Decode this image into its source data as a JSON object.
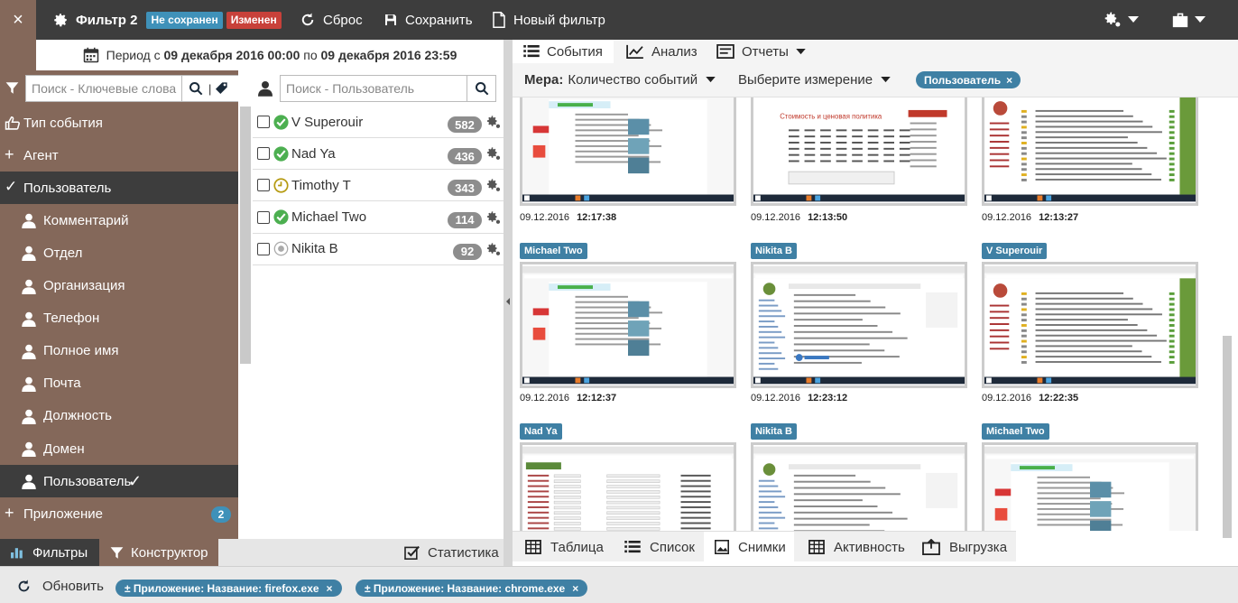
{
  "topbar": {
    "close_label": "×",
    "filter_name": "Фильтр 2",
    "badge_unsaved": "Не сохранен",
    "badge_changed": "Изменен",
    "reset_label": "Сброс",
    "save_label": "Сохранить",
    "new_filter_label": "Новый фильтр",
    "badge_unsaved_color": "#3f91b9",
    "badge_changed_color": "#c8413a"
  },
  "period": {
    "prefix": "Период с",
    "from": "09 декабря 2016 00:00",
    "middle": "по",
    "to": "09 декабря 2016 23:59"
  },
  "search": {
    "keywords_placeholder": "Поиск - Ключевые слова",
    "user_placeholder": "Поиск - Пользователь",
    "separator": "|"
  },
  "sidebar": {
    "items": [
      {
        "label": "Тип события",
        "prefix": "thumb-icon"
      },
      {
        "label": "Агент",
        "prefix": "+"
      },
      {
        "label": "Пользователь",
        "prefix": "✓"
      },
      {
        "label": "Комментарий"
      },
      {
        "label": "Отдел"
      },
      {
        "label": "Организация"
      },
      {
        "label": "Телефон"
      },
      {
        "label": "Полное имя"
      },
      {
        "label": "Почта"
      },
      {
        "label": "Должность"
      },
      {
        "label": "Домен"
      },
      {
        "label": "Пользователь",
        "suffix": "✓"
      },
      {
        "label": "Приложение",
        "prefix": "+",
        "count": "2"
      }
    ]
  },
  "users": [
    {
      "name": "V Superouir",
      "count": "582",
      "status": "ok"
    },
    {
      "name": "Nad Ya",
      "count": "436",
      "status": "ok"
    },
    {
      "name": "Timothy T",
      "count": "343",
      "status": "clock"
    },
    {
      "name": "Michael Two",
      "count": "114",
      "status": "ok"
    },
    {
      "name": "Nikita B",
      "count": "92",
      "status": "off"
    }
  ],
  "tabs_top": {
    "events": "События",
    "analysis": "Анализ",
    "reports": "Отчеты"
  },
  "measure": {
    "label": "Мера:",
    "value": "Количество событий",
    "dimension": "Выберите измерение",
    "chip": "Пользователь",
    "chip_close": "×"
  },
  "gallery": {
    "row1": [
      {
        "date": "09.12.2016",
        "time": "12:17:38"
      },
      {
        "date": "09.12.2016",
        "time": "12:13:50",
        "shot_title": "Стоимость и ценовая политика"
      },
      {
        "date": "09.12.2016",
        "time": "12:13:27"
      }
    ],
    "row2": [
      {
        "user": "Michael Two",
        "date": "09.12.2016",
        "time": "12:12:37"
      },
      {
        "user": "Nikita B",
        "date": "09.12.2016",
        "time": "12:23:12"
      },
      {
        "user": "V Superouir",
        "date": "09.12.2016",
        "time": "12:22:35"
      }
    ],
    "row3": [
      {
        "user": "Nad Ya"
      },
      {
        "user": "Nikita B"
      },
      {
        "user": "Michael Two"
      }
    ]
  },
  "tabs_bottom": {
    "table": "Таблица",
    "list": "Список",
    "snapshots": "Снимки",
    "activity": "Активность",
    "export": "Выгрузка"
  },
  "left_bottom": {
    "filters": "Фильтры",
    "constructor": "Конструктор",
    "statistics": "Статистика"
  },
  "footer": {
    "refresh": "Обновить",
    "chips": [
      "± Приложение: Название: firefox.exe",
      "± Приложение: Название: chrome.exe"
    ],
    "chip_close": "×"
  },
  "colors": {
    "brown": "#84685a",
    "dark": "#3d3d3d",
    "accent_blue": "#3f80a4",
    "ok_green": "#4caf50"
  }
}
